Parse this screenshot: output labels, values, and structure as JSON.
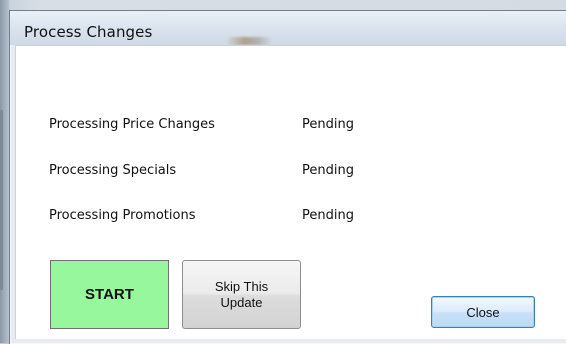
{
  "window": {
    "title": "Process Changes"
  },
  "rows": [
    {
      "label": "Processing Price Changes",
      "status": "Pending"
    },
    {
      "label": "Processing Specials",
      "status": "Pending"
    },
    {
      "label": "Processing Promotions",
      "status": "Pending"
    }
  ],
  "buttons": {
    "start_label": "START",
    "skip_label_line1": "Skip This",
    "skip_label_line2": "Update",
    "close_label": "Close"
  },
  "colors": {
    "start_button": "#97f79d",
    "close_button_border": "#3c7fb1"
  }
}
